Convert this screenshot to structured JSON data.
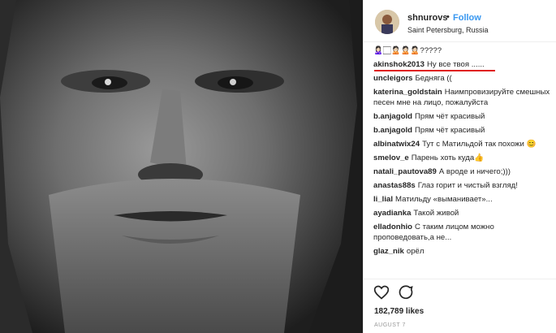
{
  "header": {
    "username": "shnurovs",
    "separator": "•",
    "follow_label": "Follow",
    "location": "Saint Petersburg, Russia"
  },
  "comments": [
    {
      "text": "🙎🏻‍♀️🏻🙎🏻🙎🏻🙎🏻?????"
    },
    {
      "user": "akinshok2013",
      "text": "Ну все твоя ......"
    },
    {
      "user": "uncleigors",
      "text": "Бедняга (("
    },
    {
      "user": "katerina_goldstain",
      "text": "Наимпровизируйте смешных песен мне на лицо, пожалуйста"
    },
    {
      "user": "b.anjagold",
      "text": "Прям чёт красивый"
    },
    {
      "user": "b.anjagold",
      "text": "Прям чёт красивый"
    },
    {
      "user": "albinatwix24",
      "text": "Тут с Матильдой так похожи 😊"
    },
    {
      "user": "smelov_e",
      "text": "Парень хоть куда👍"
    },
    {
      "user": "natali_pautova89",
      "text": "А вроде и ничего;)))"
    },
    {
      "user": "anastas88s",
      "text": "Глаз горит и чистый взгляд!"
    },
    {
      "user": "li_lial",
      "text": "Матильду «выманивает»..."
    },
    {
      "user": "ayadianka",
      "text": "Такой живой"
    },
    {
      "user": "elladonhio",
      "text": "С таким лицом можно проповедовать,а не..."
    },
    {
      "user": "glaz_nik",
      "text": "орёл"
    }
  ],
  "footer": {
    "likes": "182,789 likes",
    "date": "AUGUST 7"
  },
  "colors": {
    "accent": "#3897f0",
    "underline": "#e0201c"
  }
}
